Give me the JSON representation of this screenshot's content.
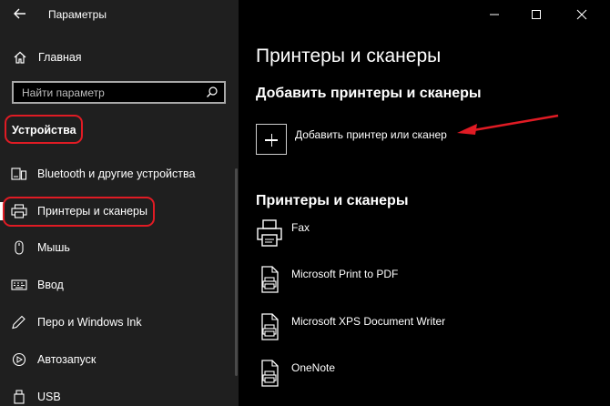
{
  "app": {
    "title": "Параметры"
  },
  "sidebar": {
    "home_label": "Главная",
    "search_placeholder": "Найти параметр",
    "section_title": "Устройства",
    "items": [
      {
        "label": "Bluetooth и другие устройства",
        "icon": "bluetooth-icon"
      },
      {
        "label": "Принтеры и сканеры",
        "icon": "printer-icon",
        "selected": true
      },
      {
        "label": "Мышь",
        "icon": "mouse-icon"
      },
      {
        "label": "Ввод",
        "icon": "keyboard-icon"
      },
      {
        "label": "Перо и Windows Ink",
        "icon": "pen-icon"
      },
      {
        "label": "Автозапуск",
        "icon": "autoplay-icon"
      },
      {
        "label": "USB",
        "icon": "usb-icon"
      }
    ]
  },
  "main": {
    "page_title": "Принтеры и сканеры",
    "add_section_title": "Добавить принтеры и сканеры",
    "add_button_label": "Добавить принтер или сканер",
    "list_title": "Принтеры и сканеры",
    "printers": [
      {
        "name": "Fax",
        "icon": "fax-icon"
      },
      {
        "name": "Microsoft Print to PDF",
        "icon": "printer-document-icon"
      },
      {
        "name": "Microsoft XPS Document Writer",
        "icon": "printer-document-icon"
      },
      {
        "name": "OneNote",
        "icon": "printer-document-icon"
      }
    ]
  },
  "colors": {
    "sidebar_bg": "#1f1f1f",
    "main_bg": "#000000",
    "annotation_red": "#e01b24"
  }
}
